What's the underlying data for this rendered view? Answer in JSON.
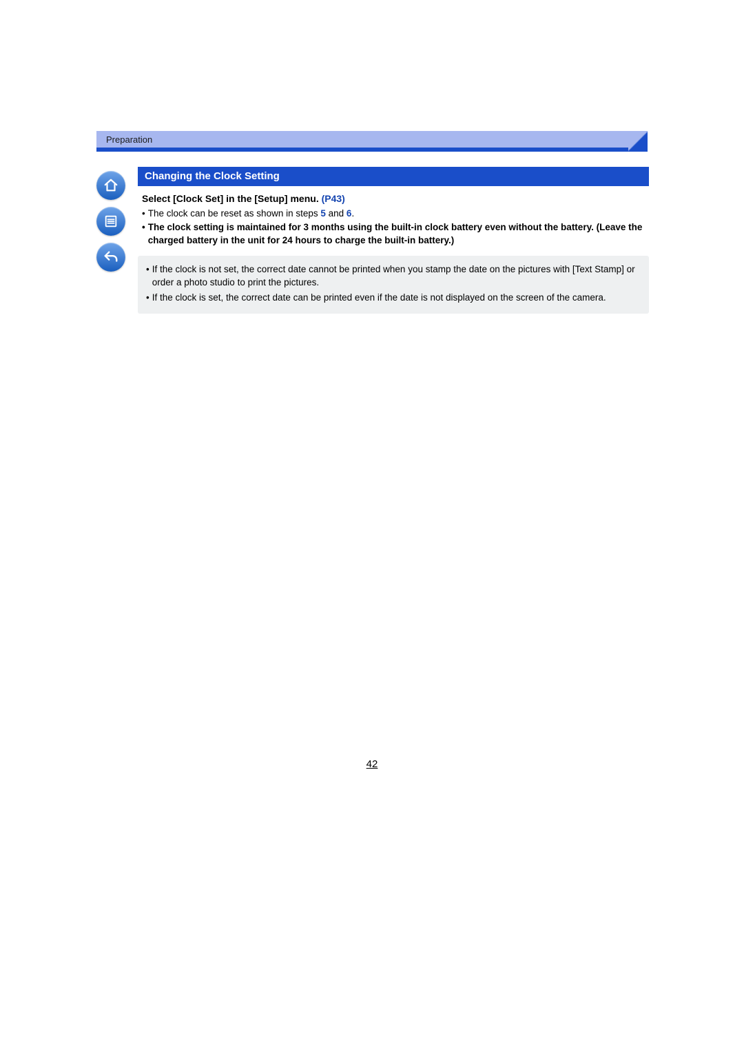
{
  "breadcrumb": "Preparation",
  "section_heading": "Changing the Clock Setting",
  "instruction": {
    "text": "Select [Clock Set] in the [Setup] menu.",
    "page_ref": "(P43)"
  },
  "bullets": {
    "b1_pre": "The clock can be reset as shown in steps ",
    "b1_step5": "5",
    "b1_mid": " and ",
    "b1_step6": "6",
    "b1_post": ".",
    "b2": "The clock setting is maintained for 3 months using the built-in clock battery even without the battery. (Leave the charged battery in the unit for 24 hours to charge the built-in battery.)"
  },
  "notes": {
    "n1": "If the clock is not set, the correct date cannot be printed when you stamp the date on the pictures with [Text Stamp] or order a photo studio to print the pictures.",
    "n2": "If the clock is set, the correct date can be printed even if the date is not displayed on the screen of the camera."
  },
  "page_number": "42",
  "dot": "•"
}
